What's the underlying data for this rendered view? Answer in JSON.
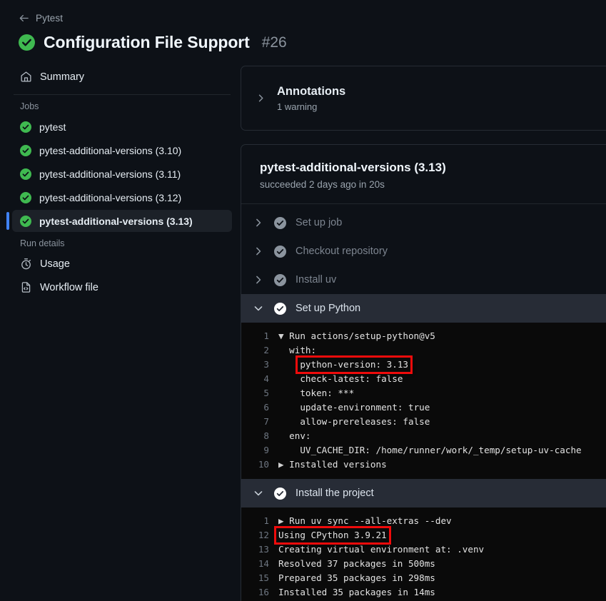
{
  "header": {
    "back_label": "Pytest",
    "back_icon": "arrow-left-icon",
    "status_icon": "success-check-icon",
    "title": "Configuration File Support",
    "run_number": "#26"
  },
  "sidebar": {
    "summary": {
      "label": "Summary",
      "icon": "home-icon"
    },
    "jobs_heading": "Jobs",
    "jobs": [
      {
        "label": "pytest",
        "status": "success",
        "selected": false
      },
      {
        "label": "pytest-additional-versions (3.10)",
        "status": "success",
        "selected": false
      },
      {
        "label": "pytest-additional-versions (3.11)",
        "status": "success",
        "selected": false
      },
      {
        "label": "pytest-additional-versions (3.12)",
        "status": "success",
        "selected": false
      },
      {
        "label": "pytest-additional-versions (3.13)",
        "status": "success",
        "selected": true
      }
    ],
    "run_details_heading": "Run details",
    "run_details": [
      {
        "label": "Usage",
        "icon": "stopwatch-icon"
      },
      {
        "label": "Workflow file",
        "icon": "file-code-icon"
      }
    ]
  },
  "annotations": {
    "title": "Annotations",
    "subtitle": "1 warning",
    "chevron": "chevron-right-icon"
  },
  "job": {
    "title": "pytest-additional-versions (3.13)",
    "status": "succeeded 2 days ago in 20s",
    "steps": [
      {
        "label": "Set up job",
        "state": "collapsed"
      },
      {
        "label": "Checkout repository",
        "state": "collapsed"
      },
      {
        "label": "Install uv",
        "state": "collapsed"
      },
      {
        "label": "Set up Python",
        "state": "expanded"
      },
      {
        "label": "Install the project",
        "state": "expanded"
      }
    ]
  },
  "logs": {
    "setup_python": [
      {
        "n": "1",
        "text": "Run actions/setup-python@v5",
        "disclosure": "open",
        "indent": 0,
        "highlight": false
      },
      {
        "n": "2",
        "text": "with:",
        "disclosure": "none",
        "indent": 1,
        "highlight": false
      },
      {
        "n": "3",
        "text": "python-version: 3.13",
        "disclosure": "none",
        "indent": 2,
        "highlight": true
      },
      {
        "n": "4",
        "text": "check-latest: false",
        "disclosure": "none",
        "indent": 2,
        "highlight": false
      },
      {
        "n": "5",
        "text": "token: ***",
        "disclosure": "none",
        "indent": 2,
        "highlight": false
      },
      {
        "n": "6",
        "text": "update-environment: true",
        "disclosure": "none",
        "indent": 2,
        "highlight": false
      },
      {
        "n": "7",
        "text": "allow-prereleases: false",
        "disclosure": "none",
        "indent": 2,
        "highlight": false
      },
      {
        "n": "8",
        "text": "env:",
        "disclosure": "none",
        "indent": 1,
        "highlight": false
      },
      {
        "n": "9",
        "text": "UV_CACHE_DIR: /home/runner/work/_temp/setup-uv-cache",
        "disclosure": "none",
        "indent": 2,
        "highlight": false
      },
      {
        "n": "10",
        "text": "Installed versions",
        "disclosure": "closed",
        "indent": 0,
        "highlight": false
      }
    ],
    "install_project": [
      {
        "n": "1",
        "text": "Run uv sync --all-extras --dev",
        "disclosure": "closed",
        "indent": 0,
        "highlight": false
      },
      {
        "n": "12",
        "text": "Using CPython 3.9.21",
        "disclosure": "none",
        "indent": 0,
        "highlight": true
      },
      {
        "n": "13",
        "text": "Creating virtual environment at: .venv",
        "disclosure": "none",
        "indent": 0,
        "highlight": false
      },
      {
        "n": "14",
        "text": "Resolved 37 packages in 500ms",
        "disclosure": "none",
        "indent": 0,
        "highlight": false
      },
      {
        "n": "15",
        "text": "Prepared 35 packages in 298ms",
        "disclosure": "none",
        "indent": 0,
        "highlight": false
      },
      {
        "n": "16",
        "text": "Installed 35 packages in 14ms",
        "disclosure": "none",
        "indent": 0,
        "highlight": false
      }
    ]
  },
  "colors": {
    "success_green": "#3fb950",
    "accent_blue": "#4082f4",
    "annotation_red": "#ee0b0b",
    "page_bg": "#0d1117",
    "log_bg": "#0a0a0a"
  }
}
